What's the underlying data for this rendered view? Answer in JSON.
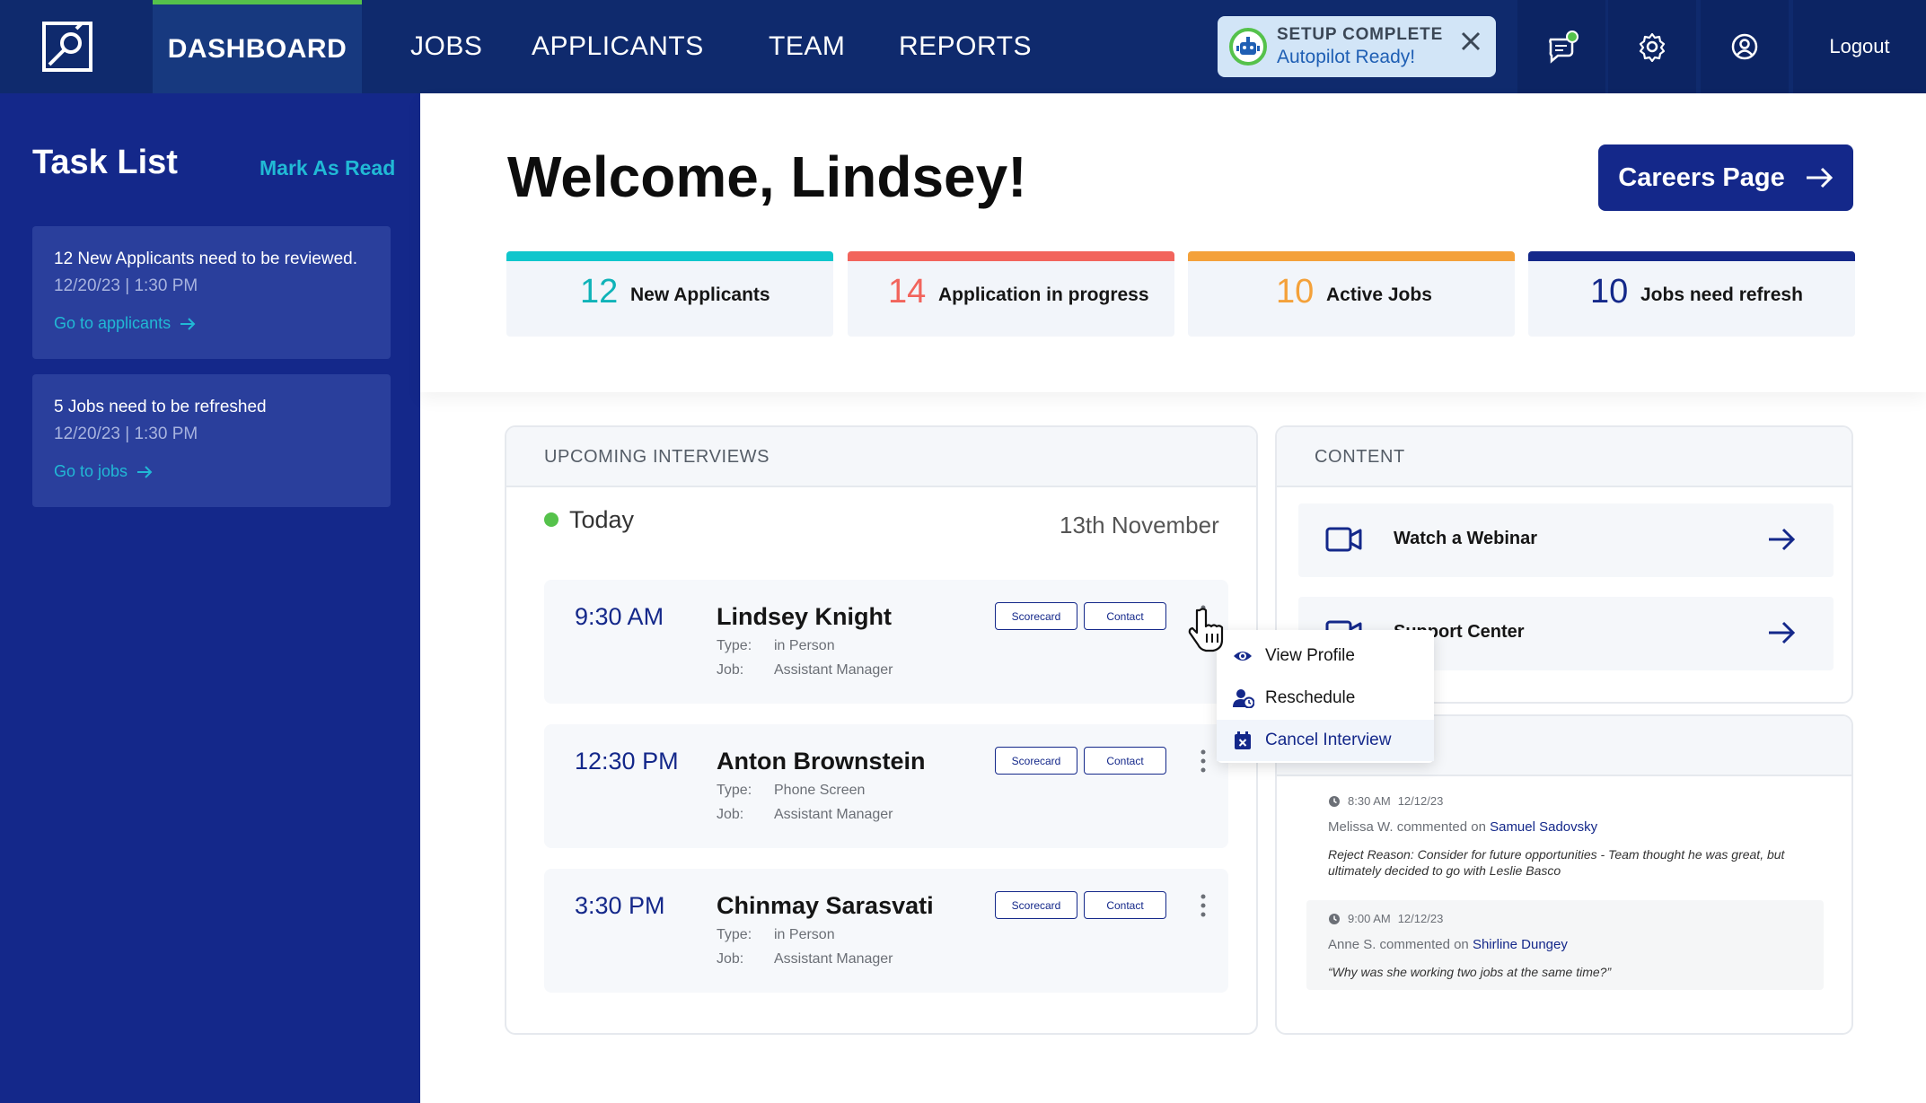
{
  "nav": {
    "items": [
      {
        "label": "DASHBOARD",
        "active": true
      },
      {
        "label": "JOBS",
        "active": false
      },
      {
        "label": "APPLICANTS",
        "active": false
      },
      {
        "label": "TEAM",
        "active": false
      },
      {
        "label": "REPORTS",
        "active": false
      }
    ],
    "setup": {
      "title": "SETUP COMPLETE",
      "subtitle": "Autopilot Ready!"
    },
    "logout": "Logout",
    "icons": [
      "chat-icon",
      "gear-icon",
      "user-icon"
    ]
  },
  "sidebar": {
    "title": "Task List",
    "mark_read": "Mark As Read",
    "tasks": [
      {
        "title": "12 New Applicants need to be reviewed.",
        "date": "12/20/23 | 1:30 PM",
        "link": "Go to applicants"
      },
      {
        "title": "5 Jobs need to be refreshed",
        "date": "12/20/23 | 1:30 PM",
        "link": "Go to jobs"
      }
    ]
  },
  "header": {
    "welcome": "Welcome, Lindsey!",
    "careers_button": "Careers Page"
  },
  "stats": [
    {
      "value": "12",
      "label": "New Applicants",
      "color": "#0fc6cc",
      "num_color": "#0fb3b8"
    },
    {
      "value": "14",
      "label": "Application in progress",
      "color": "#f2645c",
      "num_color": "#f2645c"
    },
    {
      "value": "10",
      "label": "Active Jobs",
      "color": "#f4a13a",
      "num_color": "#f4a13a"
    },
    {
      "value": "10",
      "label": "Jobs need refresh",
      "color": "#14288a",
      "num_color": "#14288a"
    }
  ],
  "interviews": {
    "title": "UPCOMING INTERVIEWS",
    "day_label": "Today",
    "date": "13th November",
    "type_key": "Type:",
    "job_key": "Job:",
    "scorecard": "Scorecard",
    "contact": "Contact",
    "items": [
      {
        "time": "9:30 AM",
        "name": "Lindsey Knight",
        "type": "in Person",
        "job": "Assistant Manager"
      },
      {
        "time": "12:30 PM",
        "name": "Anton Brownstein",
        "type": "Phone Screen",
        "job": "Assistant Manager"
      },
      {
        "time": "3:30 PM",
        "name": "Chinmay Sarasvati",
        "type": "in Person",
        "job": "Assistant Manager"
      }
    ]
  },
  "content": {
    "title": "CONTENT",
    "items": [
      {
        "label": "Watch a Webinar",
        "icon": "video-icon"
      },
      {
        "label": "Support Center",
        "icon": "video-icon"
      }
    ]
  },
  "comments": [
    {
      "time": "8:30 AM",
      "date": "12/12/23",
      "author": "Melissa W.",
      "verb": "commented on",
      "target": "Samuel Sadovsky",
      "text": "Reject Reason: Consider for future opportunities - Team thought he was great, but ultimately decided to go with Leslie Basco"
    },
    {
      "time": "9:00 AM",
      "date": "12/12/23",
      "author": "Anne S.",
      "verb": "commented on",
      "target": "Shirline Dungey",
      "text": "“Why was she working two jobs at the same time?”"
    }
  ],
  "menu": {
    "items": [
      {
        "label": "View Profile",
        "icon": "eye-icon"
      },
      {
        "label": "Reschedule",
        "icon": "user-clock-icon"
      },
      {
        "label": "Cancel Interview",
        "icon": "calendar-x-icon"
      }
    ]
  },
  "colors": {
    "nav_bg": "#0f2a6d",
    "sidebar_bg": "#14288a",
    "accent_green": "#55c24b",
    "accent_cyan": "#21b9d5",
    "primary": "#14288a"
  }
}
